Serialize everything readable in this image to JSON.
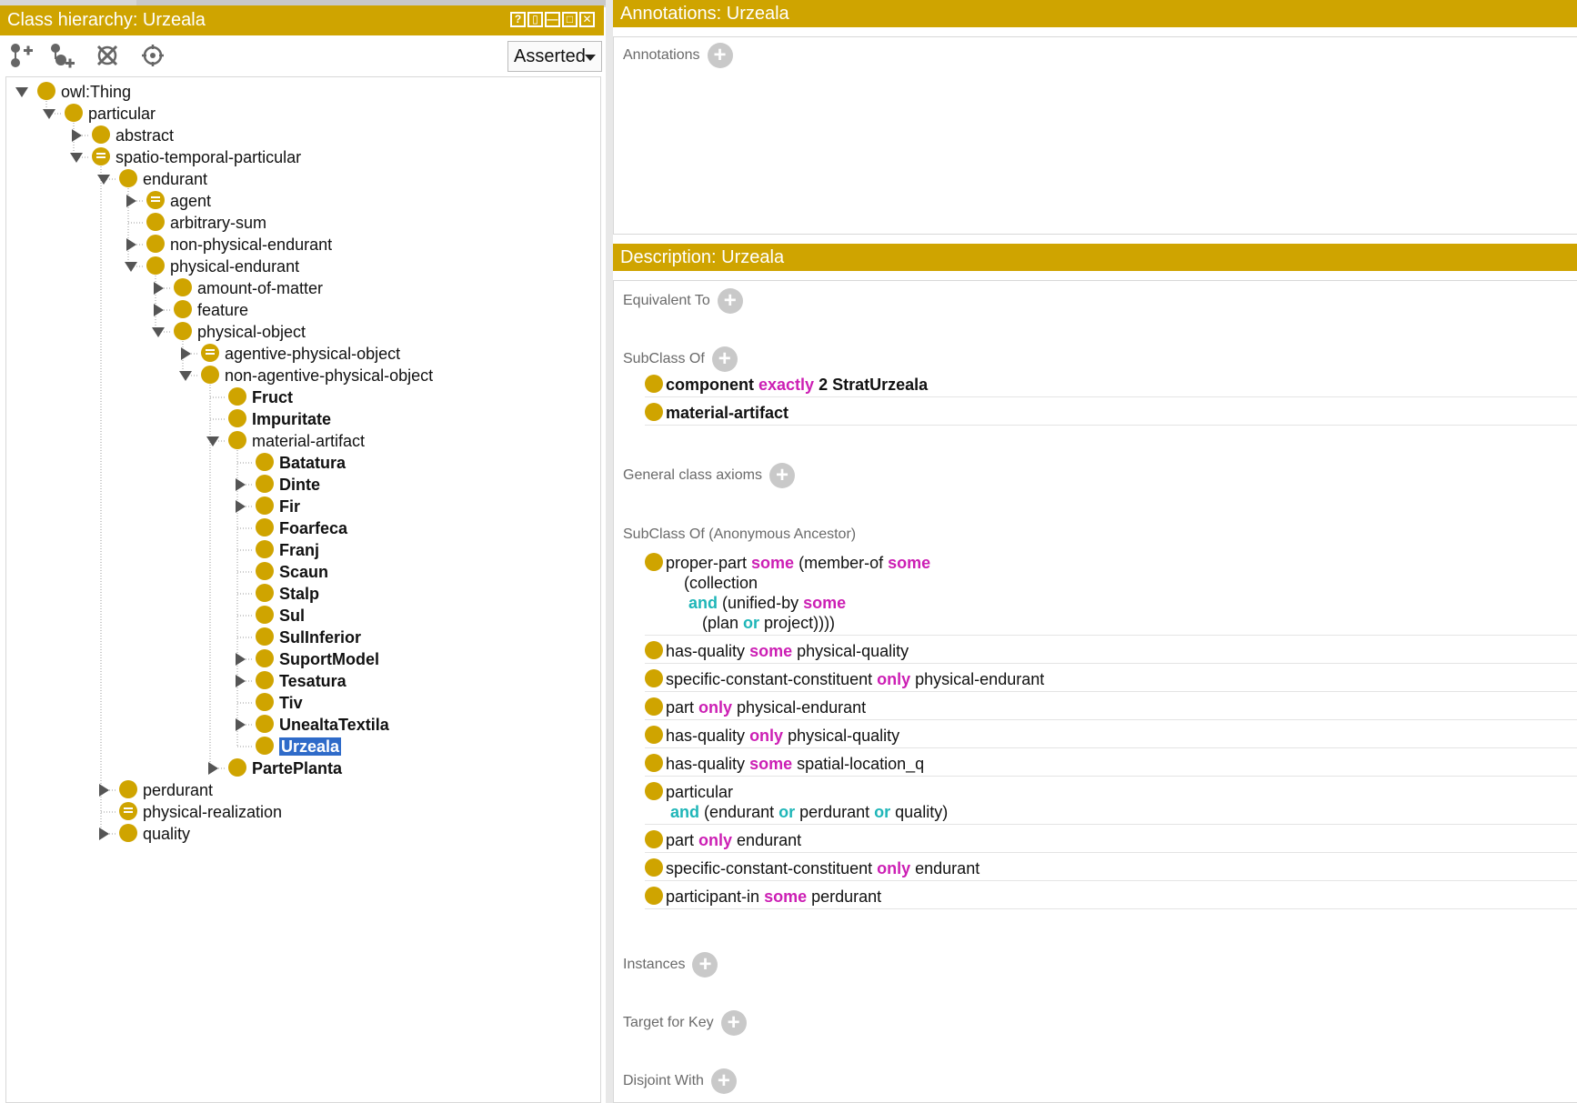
{
  "left_panel": {
    "title": "Class hierarchy: Urzeala",
    "window_buttons": [
      "?",
      "▯",
      "—",
      "□",
      "✕"
    ],
    "toolbar": {
      "icons": [
        "add-subclass-icon",
        "add-sibling-icon",
        "delete-class-icon",
        "find-icon"
      ],
      "view_select": "Asserted"
    },
    "tree": [
      {
        "label": "owl:Thing",
        "depth": 0,
        "toggle": "open",
        "equiv": false,
        "bold": false
      },
      {
        "label": "particular",
        "depth": 1,
        "toggle": "open",
        "equiv": false,
        "bold": false
      },
      {
        "label": "abstract",
        "depth": 2,
        "toggle": "closed",
        "equiv": false,
        "bold": false
      },
      {
        "label": "spatio-temporal-particular",
        "depth": 2,
        "toggle": "open",
        "equiv": true,
        "bold": false
      },
      {
        "label": "endurant",
        "depth": 3,
        "toggle": "open",
        "equiv": false,
        "bold": false
      },
      {
        "label": "agent",
        "depth": 4,
        "toggle": "closed",
        "equiv": true,
        "bold": false
      },
      {
        "label": "arbitrary-sum",
        "depth": 4,
        "toggle": "none",
        "equiv": false,
        "bold": false
      },
      {
        "label": "non-physical-endurant",
        "depth": 4,
        "toggle": "closed",
        "equiv": false,
        "bold": false
      },
      {
        "label": "physical-endurant",
        "depth": 4,
        "toggle": "open",
        "equiv": false,
        "bold": false
      },
      {
        "label": "amount-of-matter",
        "depth": 5,
        "toggle": "closed",
        "equiv": false,
        "bold": false
      },
      {
        "label": "feature",
        "depth": 5,
        "toggle": "closed",
        "equiv": false,
        "bold": false
      },
      {
        "label": "physical-object",
        "depth": 5,
        "toggle": "open",
        "equiv": false,
        "bold": false
      },
      {
        "label": "agentive-physical-object",
        "depth": 6,
        "toggle": "closed",
        "equiv": true,
        "bold": false
      },
      {
        "label": "non-agentive-physical-object",
        "depth": 6,
        "toggle": "open",
        "equiv": false,
        "bold": false
      },
      {
        "label": "Fruct",
        "depth": 7,
        "toggle": "none",
        "equiv": false,
        "bold": true
      },
      {
        "label": "Impuritate",
        "depth": 7,
        "toggle": "none",
        "equiv": false,
        "bold": true
      },
      {
        "label": "material-artifact",
        "depth": 7,
        "toggle": "open",
        "equiv": false,
        "bold": false
      },
      {
        "label": "Batatura",
        "depth": 8,
        "toggle": "none",
        "equiv": false,
        "bold": true
      },
      {
        "label": "Dinte",
        "depth": 8,
        "toggle": "closed",
        "equiv": false,
        "bold": true
      },
      {
        "label": "Fir",
        "depth": 8,
        "toggle": "closed",
        "equiv": false,
        "bold": true
      },
      {
        "label": "Foarfeca",
        "depth": 8,
        "toggle": "none",
        "equiv": false,
        "bold": true
      },
      {
        "label": "Franj",
        "depth": 8,
        "toggle": "none",
        "equiv": false,
        "bold": true
      },
      {
        "label": "Scaun",
        "depth": 8,
        "toggle": "none",
        "equiv": false,
        "bold": true
      },
      {
        "label": "Stalp",
        "depth": 8,
        "toggle": "none",
        "equiv": false,
        "bold": true
      },
      {
        "label": "Sul",
        "depth": 8,
        "toggle": "none",
        "equiv": false,
        "bold": true
      },
      {
        "label": "SulInferior",
        "depth": 8,
        "toggle": "none",
        "equiv": false,
        "bold": true
      },
      {
        "label": "SuportModel",
        "depth": 8,
        "toggle": "closed",
        "equiv": false,
        "bold": true
      },
      {
        "label": "Tesatura",
        "depth": 8,
        "toggle": "closed",
        "equiv": false,
        "bold": true
      },
      {
        "label": "Tiv",
        "depth": 8,
        "toggle": "none",
        "equiv": false,
        "bold": true
      },
      {
        "label": "UnealtaTextila",
        "depth": 8,
        "toggle": "closed",
        "equiv": false,
        "bold": true
      },
      {
        "label": "Urzeala",
        "depth": 8,
        "toggle": "none",
        "equiv": false,
        "bold": true,
        "selected": true
      },
      {
        "label": "PartePlanta",
        "depth": 7,
        "toggle": "closed",
        "equiv": false,
        "bold": true
      },
      {
        "label": "perdurant",
        "depth": 3,
        "toggle": "closed",
        "equiv": false,
        "bold": false
      },
      {
        "label": "physical-realization",
        "depth": 3,
        "toggle": "none",
        "equiv": true,
        "bold": false
      },
      {
        "label": "quality",
        "depth": 3,
        "toggle": "closed",
        "equiv": false,
        "bold": false
      }
    ]
  },
  "annotations_panel": {
    "title": "Annotations: Urzeala",
    "section_label": "Annotations"
  },
  "description_panel": {
    "title": "Description: Urzeala",
    "sections": {
      "equivalent_to": "Equivalent To",
      "subclass_of": "SubClass Of",
      "general_axioms": "General class axioms",
      "anon_ancestor": "SubClass Of (Anonymous Ancestor)",
      "instances": "Instances",
      "target_for_key": "Target for Key",
      "disjoint_with": "Disjoint With"
    },
    "subclass_of_axioms": [
      [
        [
          {
            "t": "component ",
            "s": "bold"
          },
          {
            "t": "exactly",
            "s": "m"
          },
          {
            "t": " 2 StratUrzeala",
            "s": "bold"
          }
        ]
      ],
      [
        [
          {
            "t": "material-artifact",
            "s": "bold"
          }
        ]
      ]
    ],
    "ancestor_axioms": [
      [
        [
          {
            "t": "proper-part ",
            "s": ""
          },
          {
            "t": "some",
            "s": "m"
          },
          {
            "t": " (member-of ",
            "s": ""
          },
          {
            "t": "some",
            "s": "m"
          }
        ],
        [
          {
            "t": "    (collection",
            "s": ""
          }
        ],
        [
          {
            "t": "     ",
            "s": ""
          },
          {
            "t": "and",
            "s": "c"
          },
          {
            "t": " (unified-by ",
            "s": ""
          },
          {
            "t": "some",
            "s": "m"
          }
        ],
        [
          {
            "t": "        (plan ",
            "s": ""
          },
          {
            "t": "or",
            "s": "c"
          },
          {
            "t": " project))))",
            "s": ""
          }
        ]
      ],
      [
        [
          {
            "t": "has-quality ",
            "s": ""
          },
          {
            "t": "some",
            "s": "m"
          },
          {
            "t": " physical-quality",
            "s": ""
          }
        ]
      ],
      [
        [
          {
            "t": "specific-constant-constituent ",
            "s": ""
          },
          {
            "t": "only",
            "s": "m"
          },
          {
            "t": " physical-endurant",
            "s": ""
          }
        ]
      ],
      [
        [
          {
            "t": "part ",
            "s": ""
          },
          {
            "t": "only",
            "s": "m"
          },
          {
            "t": " physical-endurant",
            "s": ""
          }
        ]
      ],
      [
        [
          {
            "t": "has-quality ",
            "s": ""
          },
          {
            "t": "only",
            "s": "m"
          },
          {
            "t": " physical-quality",
            "s": ""
          }
        ]
      ],
      [
        [
          {
            "t": "has-quality ",
            "s": ""
          },
          {
            "t": "some",
            "s": "m"
          },
          {
            "t": " spatial-location_q",
            "s": ""
          }
        ]
      ],
      [
        [
          {
            "t": "particular",
            "s": ""
          }
        ],
        [
          {
            "t": " ",
            "s": ""
          },
          {
            "t": "and",
            "s": "c"
          },
          {
            "t": " (endurant ",
            "s": ""
          },
          {
            "t": "or",
            "s": "c"
          },
          {
            "t": " perdurant ",
            "s": ""
          },
          {
            "t": "or",
            "s": "c"
          },
          {
            "t": " quality)",
            "s": ""
          }
        ]
      ],
      [
        [
          {
            "t": "part ",
            "s": ""
          },
          {
            "t": "only",
            "s": "m"
          },
          {
            "t": " endurant",
            "s": ""
          }
        ]
      ],
      [
        [
          {
            "t": "specific-constant-constituent ",
            "s": ""
          },
          {
            "t": "only",
            "s": "m"
          },
          {
            "t": " endurant",
            "s": ""
          }
        ]
      ],
      [
        [
          {
            "t": "participant-in ",
            "s": ""
          },
          {
            "t": "some",
            "s": "m"
          },
          {
            "t": " perdurant",
            "s": ""
          }
        ]
      ]
    ]
  },
  "colors": {
    "accent": "#cfa400",
    "keyword_magenta": "#cc1fb4",
    "keyword_cyan": "#1fb6b8",
    "selection": "#2f6bc9"
  }
}
